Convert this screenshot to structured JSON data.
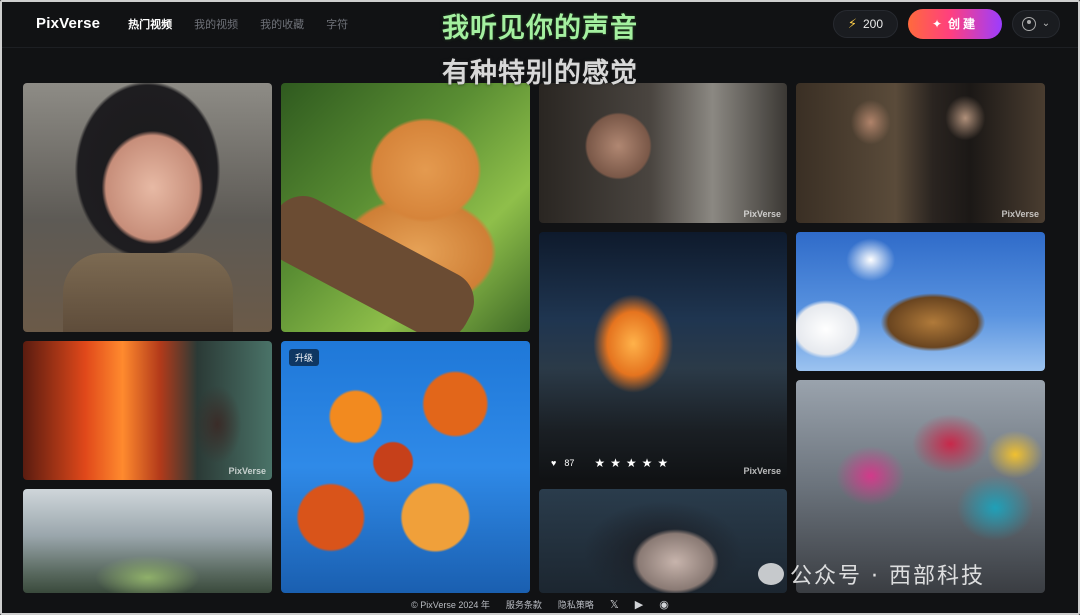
{
  "app": {
    "logo": "PixVerse"
  },
  "nav": [
    {
      "label": "热门视频",
      "active": true
    },
    {
      "label": "我的视频",
      "active": false
    },
    {
      "label": "我的收藏",
      "active": false
    },
    {
      "label": "字符",
      "active": false
    }
  ],
  "header": {
    "credits": "200",
    "create_label": "创建",
    "credits_icon": "bolt-icon",
    "create_icon": "sparkle-icon"
  },
  "subtitle": {
    "line1": "我听见你的声音",
    "line2": "有种特别的感觉"
  },
  "gallery": {
    "watermark": "PixVerse",
    "upgrade_badge": "升级",
    "featured": {
      "likes": "87",
      "rating": 5
    }
  },
  "footer": {
    "copyright": "© PixVerse 2024 年",
    "terms": "服务条款",
    "privacy": "隐私策略",
    "icons": [
      "x-icon",
      "youtube-icon",
      "discord-icon"
    ]
  },
  "overlay_watermark": "公众号 · 西部科技",
  "colors": {
    "accent_gradient": [
      "#ff6a3d",
      "#ff3f7f",
      "#9b3dff"
    ],
    "subtitle_green": "#a4f0a0"
  }
}
